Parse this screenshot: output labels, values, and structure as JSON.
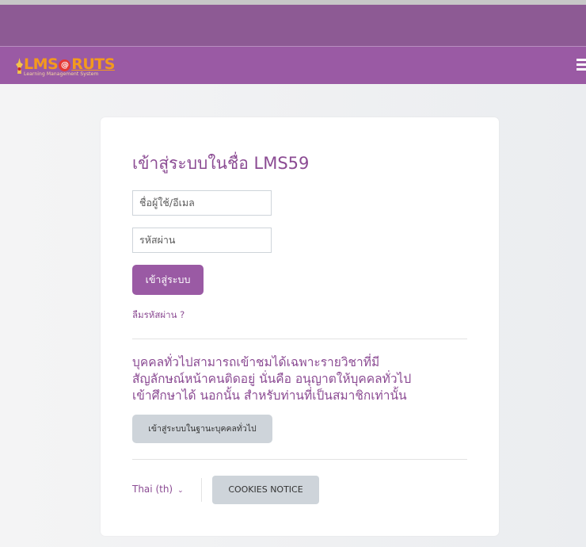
{
  "header": {
    "logo": {
      "main_lms": "LMS",
      "main_at": "@",
      "main_ruts": "RUTS",
      "subtitle": "Learning Management System"
    },
    "menu_icon": "hamburger-icon"
  },
  "login": {
    "title": "เข้าสู่ระบบในชื่อ LMS59",
    "username_placeholder": "ชื่อผู้ใช้/อีเมล",
    "password_placeholder": "รหัสผ่าน",
    "login_button": "เข้าสู่ระบบ",
    "forgot_link": "ลืมรหัสผ่าน ?"
  },
  "guest": {
    "text_lines": [
      "บุคคลทั่วไปสามารถเข้าชมได้เฉพาะรายวิชาที่มี",
      "สัญลักษณ์หน้าคนติดอยู่ นั่นคือ อนุญาตให้บุคคลทั่วไป",
      "เข้าศึกษาได้ นอกนั้น สำหรับท่านที่เป็นสมาชิกเท่านั้น"
    ],
    "guest_button": "เข้าสู่ระบบในฐานะบุคคลทั่วไป"
  },
  "footer": {
    "language": "Thai (th)",
    "cookies_button": "COOKIES NOTICE"
  },
  "colors": {
    "brand_purple": "#9a5aa4",
    "top_strip": "#8d5a94",
    "text_purple": "#8b4b93",
    "logo_orange": "#f39a1e"
  }
}
